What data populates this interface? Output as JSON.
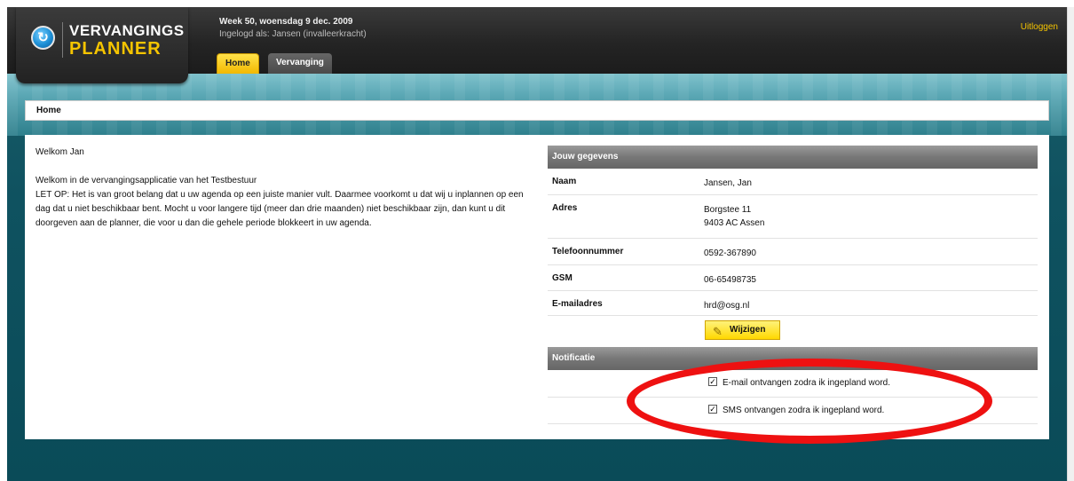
{
  "logo": {
    "line1": "VERVANGINGS",
    "line2": "PLANNER",
    "symbol": "↻"
  },
  "header": {
    "week": "Week 50, woensdag 9 dec. 2009",
    "logged_in": "Ingelogd als: Jansen (invalleerkracht)",
    "logout": "Uitloggen"
  },
  "tabs": {
    "home": "Home",
    "vervanging": "Vervanging"
  },
  "breadcrumb": "Home",
  "welcome": "Welkom Jan",
  "intro": {
    "line1": "Welkom in de vervangingsapplicatie van het Testbestuur",
    "line2": "LET OP: Het is van groot belang dat u uw agenda op een juiste manier vult. Daarmee voorkomt u dat wij u inplannen op een dag dat u niet beschikbaar bent. Mocht u voor langere tijd (meer dan drie maanden) niet beschikbaar zijn, dan kunt u dit doorgeven aan de planner, die voor u dan die gehele periode blokkeert in uw agenda."
  },
  "details": {
    "title": "Jouw gegevens",
    "naam_label": "Naam",
    "naam": "Jansen, Jan",
    "adres_label": "Adres",
    "adres1": "Borgstee 11",
    "adres2": "9403 AC Assen",
    "tel_label": "Telefoonnummer",
    "tel": "0592-367890",
    "gsm_label": "GSM",
    "gsm": "06-65498735",
    "email_label": "E-mailadres",
    "email": "hrd@osg.nl",
    "edit_button": "Wijzigen"
  },
  "notification": {
    "title": "Notificatie",
    "email_option": "E-mail ontvangen zodra ik ingepland word.",
    "email_checked": true,
    "sms_option": "SMS ontvangen zodra ik ingepland word.",
    "sms_checked": true,
    "check_mark": "✓"
  },
  "colors": {
    "accent": "#f5c400",
    "highlight": "#ee1111",
    "teal": "#0f5260"
  }
}
